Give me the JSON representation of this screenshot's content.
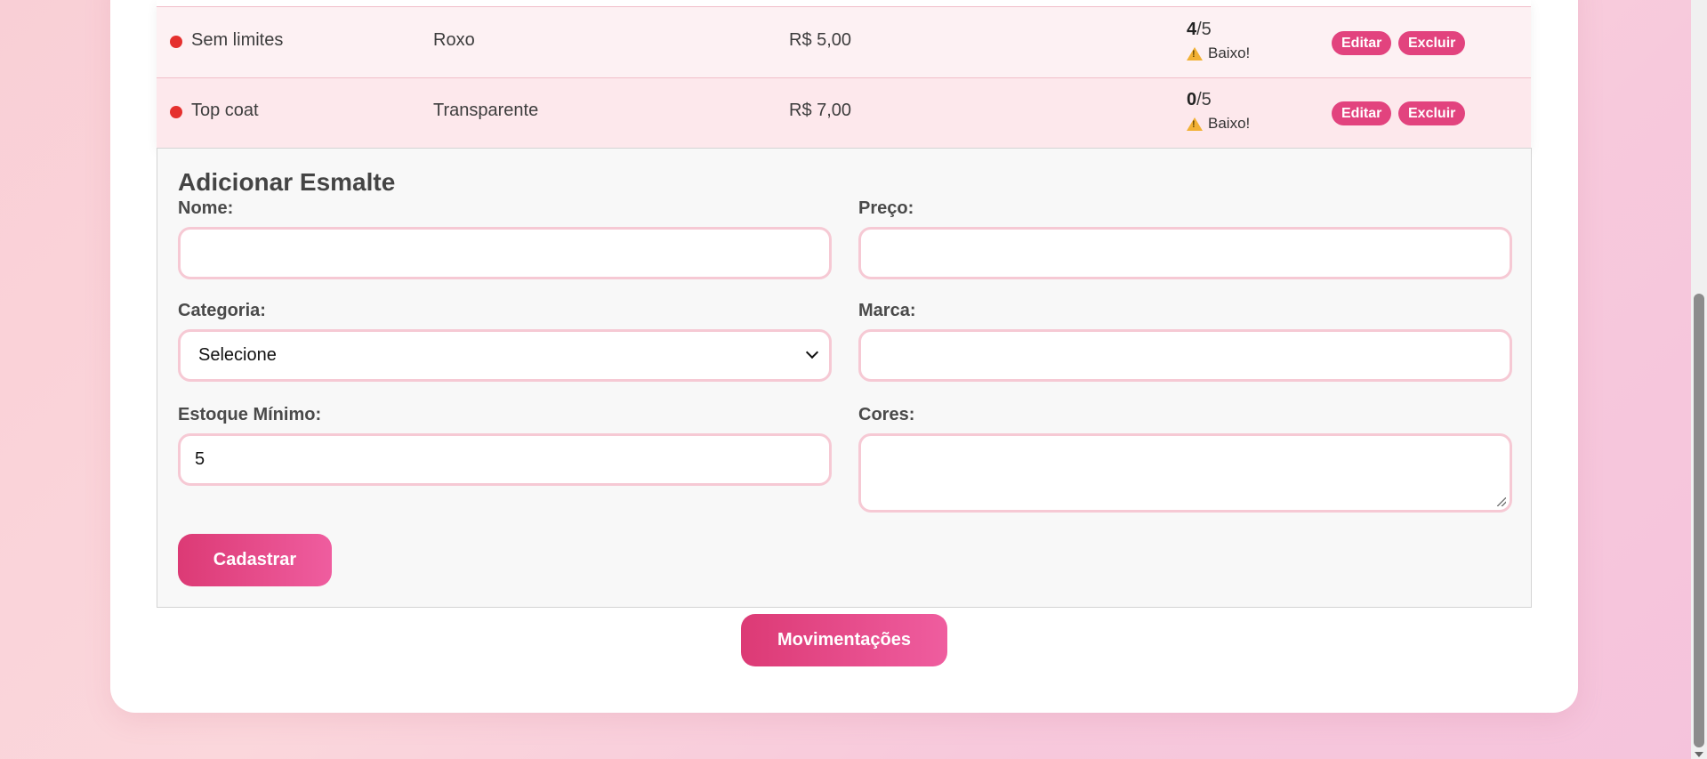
{
  "table": {
    "rows": [
      {
        "name": "Sem limites",
        "category": "Roxo",
        "price": "R$ 5,00",
        "stock_current": "4",
        "stock_min": "/5",
        "low_label": "Baixo!",
        "edit_label": "Editar",
        "delete_label": "Excluir"
      },
      {
        "name": "Top coat",
        "category": "Transparente",
        "price": "R$ 7,00",
        "stock_current": "0",
        "stock_min": "/5",
        "low_label": "Baixo!",
        "edit_label": "Editar",
        "delete_label": "Excluir"
      }
    ],
    "status_color": "#e5302e"
  },
  "form": {
    "title": "Adicionar Esmalte",
    "name_label": "Nome:",
    "name_value": "",
    "price_label": "Preço:",
    "price_value": "",
    "category_label": "Categoria:",
    "category_selected": "Selecione",
    "brand_label": "Marca:",
    "brand_value": "",
    "min_stock_label": "Estoque Mínimo:",
    "min_stock_value": "5",
    "colors_label": "Cores:",
    "colors_value": "",
    "submit_label": "Cadastrar"
  },
  "movements_label": "Movimentações",
  "accent_color": "#e2437e"
}
